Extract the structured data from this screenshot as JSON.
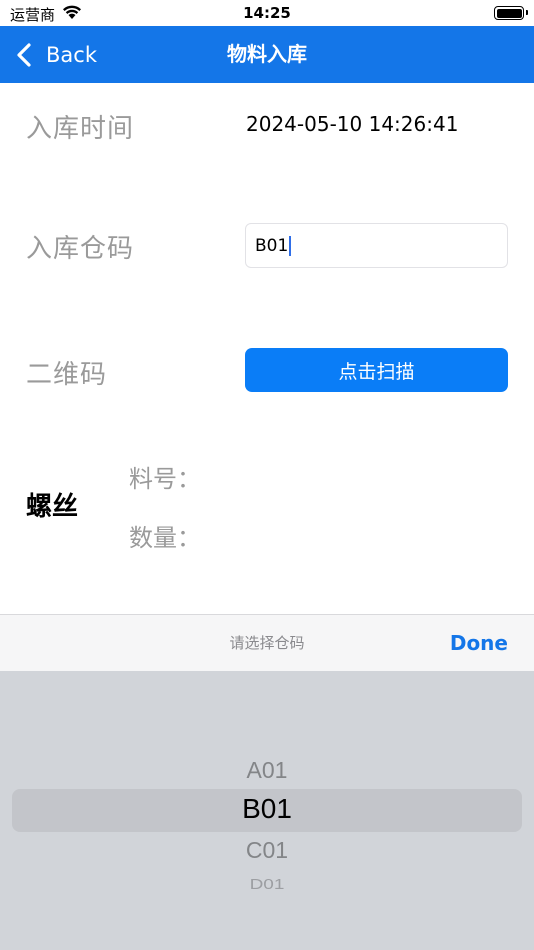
{
  "status_bar": {
    "carrier": "运营商",
    "time": "14:25"
  },
  "nav": {
    "back_label": "Back",
    "title": "物料入库"
  },
  "form": {
    "time_label": "入库时间",
    "time_value": "2024-05-10 14:26:41",
    "warehouse_label": "入库仓码",
    "warehouse_value": "B01",
    "qrcode_label": "二维码",
    "scan_button": "点击扫描"
  },
  "item": {
    "name": "螺丝",
    "part_no_label": "料号：",
    "qty_label": "数量："
  },
  "picker": {
    "title": "请选择仓码",
    "done_label": "Done",
    "options": [
      "A01",
      "B01",
      "C01",
      "D01"
    ],
    "selected": "B01"
  },
  "colors": {
    "accent": "#1476e8",
    "button": "#0a7df7",
    "picker_bg": "#d1d4d9"
  }
}
